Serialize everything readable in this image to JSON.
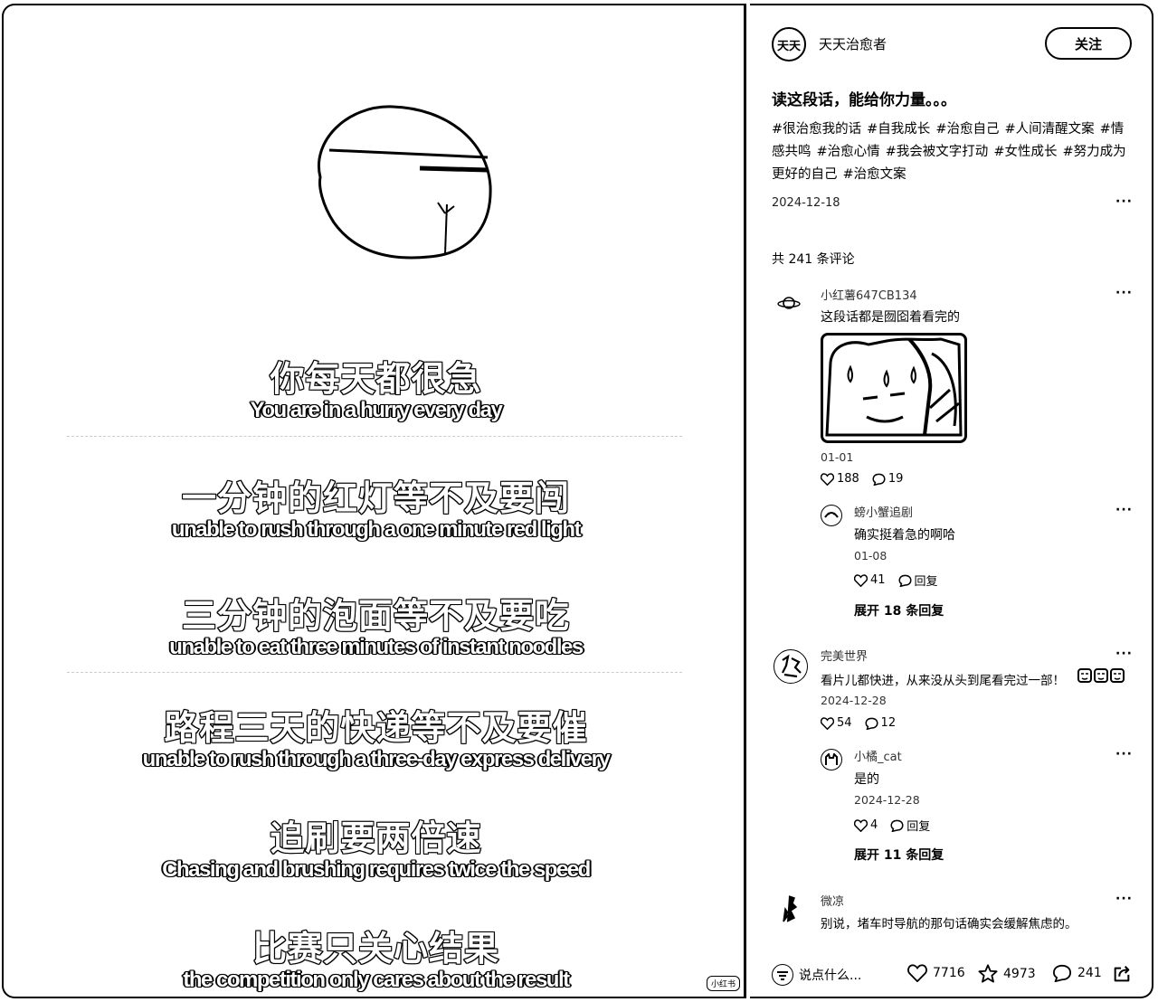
{
  "video": {
    "subtitles": [
      {
        "cn": "你每天都很急",
        "en": "You are in a hurry every day"
      },
      {
        "cn": "一分钟的红灯等不及要闯",
        "en": "unable to rush through a one minute red light"
      },
      {
        "cn": "三分钟的泡面等不及要吃",
        "en": "unable to eat three minutes of instant noodles"
      },
      {
        "cn": "路程三天的快递等不及要催",
        "en": "unable to rush through a three-day express delivery"
      },
      {
        "cn": "追刷要两倍速",
        "en": "Chasing and brushing requires twice the speed"
      },
      {
        "cn": "比赛只关心结果",
        "en": "the competition only cares about the result"
      }
    ],
    "watermark": "小红书"
  },
  "post": {
    "author": {
      "name": "天天治愈者",
      "avatar_text": "天天"
    },
    "follow_label": "关注",
    "title": "读这段话，能给你力量。。。",
    "tags": [
      "#很治愈我的话",
      "#自我成长",
      "#治愈自己",
      "#人间清醒文案",
      "#情感共鸣",
      "#治愈心情",
      "#我会被文字打动",
      "#女性成长",
      "#努力成为更好的自己",
      "#治愈文案"
    ],
    "date": "2024-12-18",
    "more": "···"
  },
  "comments_header": "共 241 条评论",
  "comments": [
    {
      "user": "小红薯647CB134",
      "text": "这段话都是囫囵着看完的",
      "date": "01-01",
      "likes": "188",
      "replies": "19"
    },
    {
      "user": "螃小蟹追剧",
      "text": "确实挺着急的啊哈",
      "date": "01-08",
      "likes": "41",
      "reply_label": "回复",
      "expand": "展开 18 条回复"
    },
    {
      "user": "完美世界",
      "text": "看片儿都快进，从来没从头到尾看完过一部！",
      "date": "2024-12-28",
      "likes": "54",
      "replies": "12"
    },
    {
      "user": "小橘_cat",
      "text": "是的",
      "date": "2024-12-28",
      "likes": "4",
      "reply_label": "回复",
      "expand": "展开 11 条回复"
    },
    {
      "user": "微凉",
      "text": "别说，堵车时导航的那句话确实会缓解焦虑的。"
    }
  ],
  "bottom": {
    "input_placeholder": "说点什么...",
    "likes": "7716",
    "stars": "4973",
    "comments": "241"
  }
}
